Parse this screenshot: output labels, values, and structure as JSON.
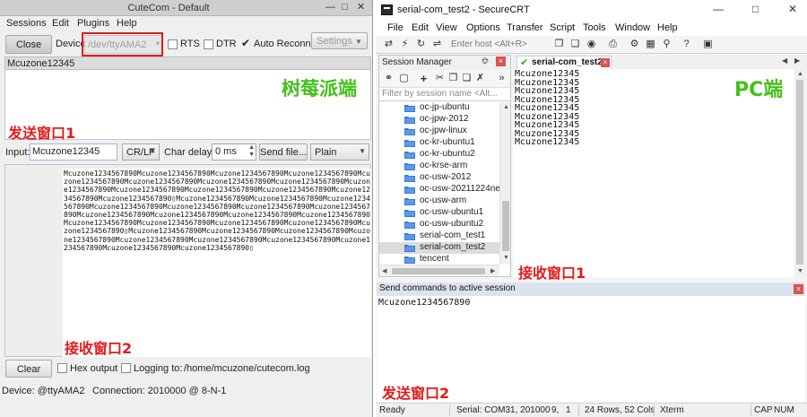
{
  "cutecom": {
    "title": "CuteCom - Default",
    "menu": [
      "Sessions",
      "Edit",
      "Plugins",
      "Help"
    ],
    "toolbar": {
      "close_label": "Close",
      "device_label": "Device:",
      "device_value": "/dev/ttyAMA2",
      "rts_label": "RTS",
      "dtr_label": "DTR",
      "auto_reconnect_label": "Auto Reconnect",
      "settings_label": "Settings"
    },
    "output_header": "Mcuzone12345",
    "input": {
      "label": "Input:",
      "value": "Mcuzone12345",
      "line_end": "CR/LF",
      "char_delay_label": "Char delay:",
      "char_delay_value": "0 ms",
      "send_file_label": "Send file...",
      "mode": "Plain"
    },
    "received_text": "Mcuzone1234567890Mcuzone1234567890Mcuzone1234567890Mcuzone1234567890Mcuzone1234567890Mcuzone1234567890Mcuzone1234567890Mcuzone1234567890Mcuzone1234567890Mcuzone1234567890Mcuzone1234567890Mcuzone1234567890Mcuzone1234567890Mcuzone1234567890▯Mcuzone1234567890Mcuzone1234567890Mcuzone1234567890Mcuzone1234567890Mcuzone1234567890Mcuzone1234567890Mcuzone1234567890Mcuzone1234567890Mcuzone1234567890Mcuzone1234567890Mcuzone1234567890Mcuzone1234567890Mcuzone1234567890Mcuzone1234567890Mcuzone1234567890Mcuzone1234567890▯Mcuzone1234567890Mcuzone1234567890Mcuzone1234567890Mcuzone1234567890Mcuzone1234567890Mcuzone1234567890Mcuzone1234567890Mcuzone1234567890Mcuzone1234567890Mcuzone1234567890▯",
    "bottom": {
      "clear_label": "Clear",
      "hex_output_label": "Hex output",
      "logging_label": "Logging to:",
      "log_path": "/home/mcuzone/cutecom.log"
    },
    "status": {
      "device": "Device:   @ttyAMA2",
      "connection": "Connection:  2010000 @ 8-N-1"
    },
    "annotations": {
      "platform": "树莓派端",
      "send_window": "发送窗口1",
      "receive_window": "接收窗口2"
    }
  },
  "securecrt": {
    "title": "serial-com_test2 - SecureCRT",
    "menu": [
      "File",
      "Edit",
      "View",
      "Options",
      "Transfer",
      "Script",
      "Tools",
      "Window",
      "Help"
    ],
    "host_placeholder": "Enter host <Alt+R>",
    "session_manager": {
      "title": "Session Manager",
      "filter_placeholder": "Filter by session name <Alt...",
      "items": [
        "oc-jp-ubuntu",
        "oc-jpw-2012",
        "oc-jpw-linux",
        "oc-kr-ubuntu1",
        "oc-kr-ubuntu2",
        "oc-krse-arm",
        "oc-usw-2012",
        "oc-usw-20211224ne",
        "oc-usw-arm",
        "oc-usw-ubuntu1",
        "oc-usw-ubuntu2",
        "serial-com_test1",
        "serial-com_test2",
        "tencent"
      ],
      "selected_index": 12
    },
    "tab_label": "serial-com_test2",
    "terminal_lines": [
      "Mcuzone12345",
      "Mcuzone12345",
      "Mcuzone12345",
      "Mcuzone12345",
      "Mcuzone12345",
      "Mcuzone12345",
      "Mcuzone12345",
      "Mcuzone12345",
      "Mcuzone12345"
    ],
    "send_commands": {
      "title": "Send commands to active session",
      "text": "Mcuzone1234567890"
    },
    "status": {
      "ready": "Ready",
      "serial": "Serial: COM31, 201000",
      "row": "9,",
      "col": "1",
      "size": "24 Rows, 52 Cols",
      "term": "Xterm",
      "cap": "CAP",
      "num": "NUM"
    },
    "annotations": {
      "platform": "PC端",
      "receive_window": "接收窗口1",
      "send_window": "发送窗口2"
    }
  }
}
